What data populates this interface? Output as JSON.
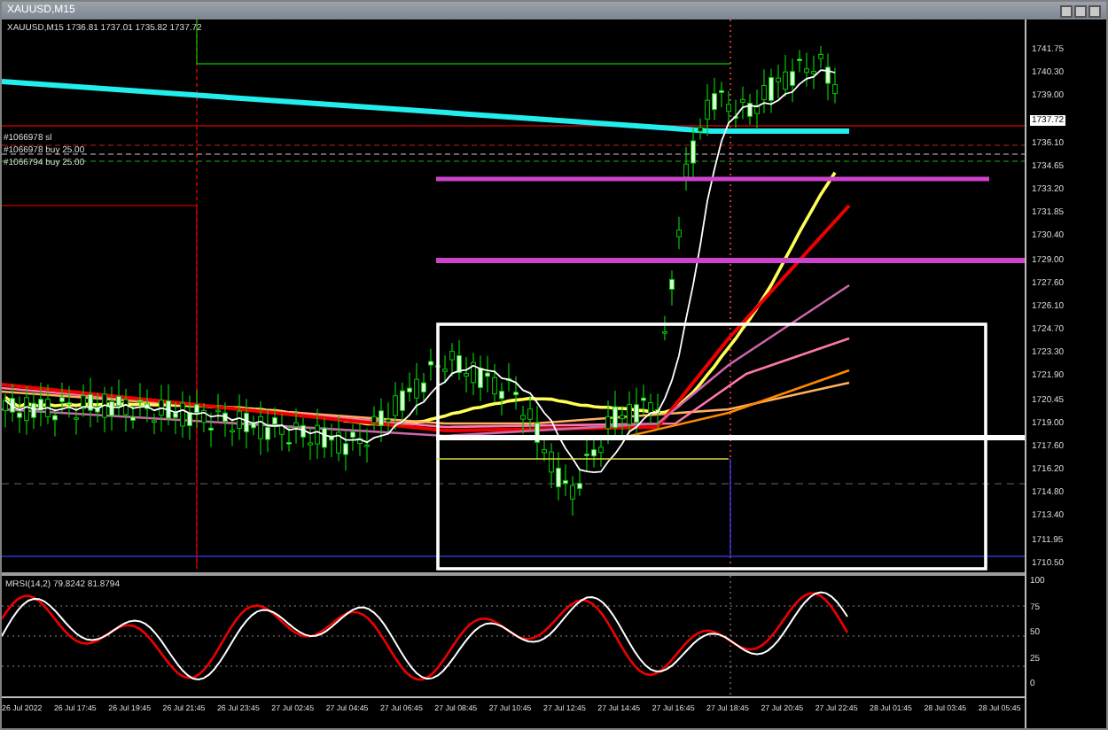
{
  "window": {
    "title": "XAUUSD,M15"
  },
  "chart": {
    "header": "XAUUSD,M15  1736.81 1737.01 1735.82 1737.72",
    "order_labels": [
      "#1066978 sl",
      "#1066978 buy 25.00",
      "#1066794 buy 25.00"
    ],
    "price_ticks": [
      {
        "label": "1741.75",
        "kind": "tick"
      },
      {
        "label": "1740.30",
        "kind": "tick"
      },
      {
        "label": "1739.00",
        "kind": "tick"
      },
      {
        "label": "1737.72",
        "kind": "current"
      },
      {
        "label": "1736.10",
        "kind": "tick"
      },
      {
        "label": "1734.65",
        "kind": "tick"
      },
      {
        "label": "1733.20",
        "kind": "tick"
      },
      {
        "label": "1731.85",
        "kind": "tick"
      },
      {
        "label": "1730.40",
        "kind": "tick"
      },
      {
        "label": "1729.00",
        "kind": "tick"
      },
      {
        "label": "1727.60",
        "kind": "tick"
      },
      {
        "label": "1726.10",
        "kind": "tick"
      },
      {
        "label": "1724.70",
        "kind": "tick"
      },
      {
        "label": "1723.30",
        "kind": "tick"
      },
      {
        "label": "1721.90",
        "kind": "tick"
      },
      {
        "label": "1720.45",
        "kind": "tick"
      },
      {
        "label": "1719.00",
        "kind": "tick"
      },
      {
        "label": "1717.60",
        "kind": "tick"
      },
      {
        "label": "1716.20",
        "kind": "tick"
      },
      {
        "label": "1714.80",
        "kind": "tick"
      },
      {
        "label": "1713.40",
        "kind": "tick"
      },
      {
        "label": "1711.95",
        "kind": "tick"
      },
      {
        "label": "1710.50",
        "kind": "tick"
      }
    ]
  },
  "indicator": {
    "label": "MRSI(14,2) 79.8242 81.8794",
    "ticks": [
      "100",
      "75",
      "50",
      "25",
      "0"
    ]
  },
  "time_axis": [
    "26 Jul 2022",
    "26 Jul 17:45",
    "26 Jul 19:45",
    "26 Jul 21:45",
    "26 Jul 23:45",
    "27 Jul 02:45",
    "27 Jul 04:45",
    "27 Jul 06:45",
    "27 Jul 08:45",
    "27 Jul 10:45",
    "27 Jul 12:45",
    "27 Jul 14:45",
    "27 Jul 16:45",
    "27 Jul 18:45",
    "27 Jul 20:45",
    "27 Jul 22:45",
    "28 Jul 01:45",
    "28 Jul 03:45",
    "28 Jul 05:45"
  ]
}
